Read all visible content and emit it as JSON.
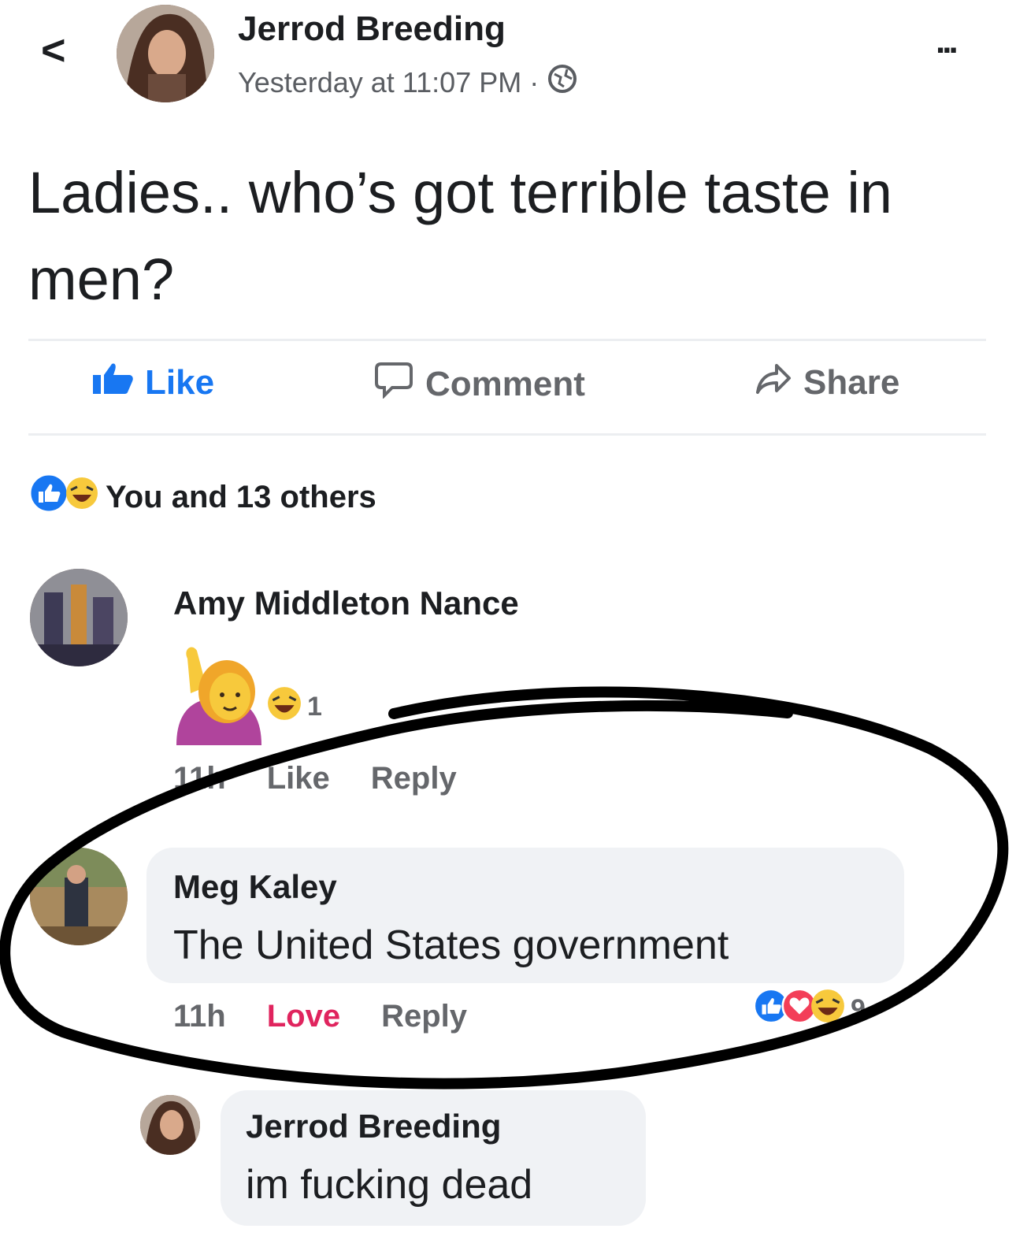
{
  "header": {
    "back_glyph": "<",
    "author": "Jerrod Breeding",
    "timestamp": "Yesterday at 11:07 PM",
    "separator": "·",
    "more_glyph": "..."
  },
  "post": {
    "text": "Ladies.. who’s got terrible taste in men?"
  },
  "actions": {
    "like": "Like",
    "comment": "Comment",
    "share": "Share"
  },
  "reactions": {
    "summary": "You and 13 others"
  },
  "comments": [
    {
      "author": "Amy Middleton Nance",
      "reaction_count": "1",
      "time": "11h",
      "like": "Like",
      "reply": "Reply"
    },
    {
      "author": "Meg Kaley",
      "text": "The United States government",
      "time": "11h",
      "love": "Love",
      "reply": "Reply",
      "reaction_count": "9"
    },
    {
      "author": "Jerrod Breeding",
      "text": "im fucking dead"
    }
  ],
  "colors": {
    "accent": "#1877f2",
    "love": "#e0245e",
    "text": "#1c1e21",
    "muted": "#65676b",
    "bubble": "#f0f2f5"
  }
}
